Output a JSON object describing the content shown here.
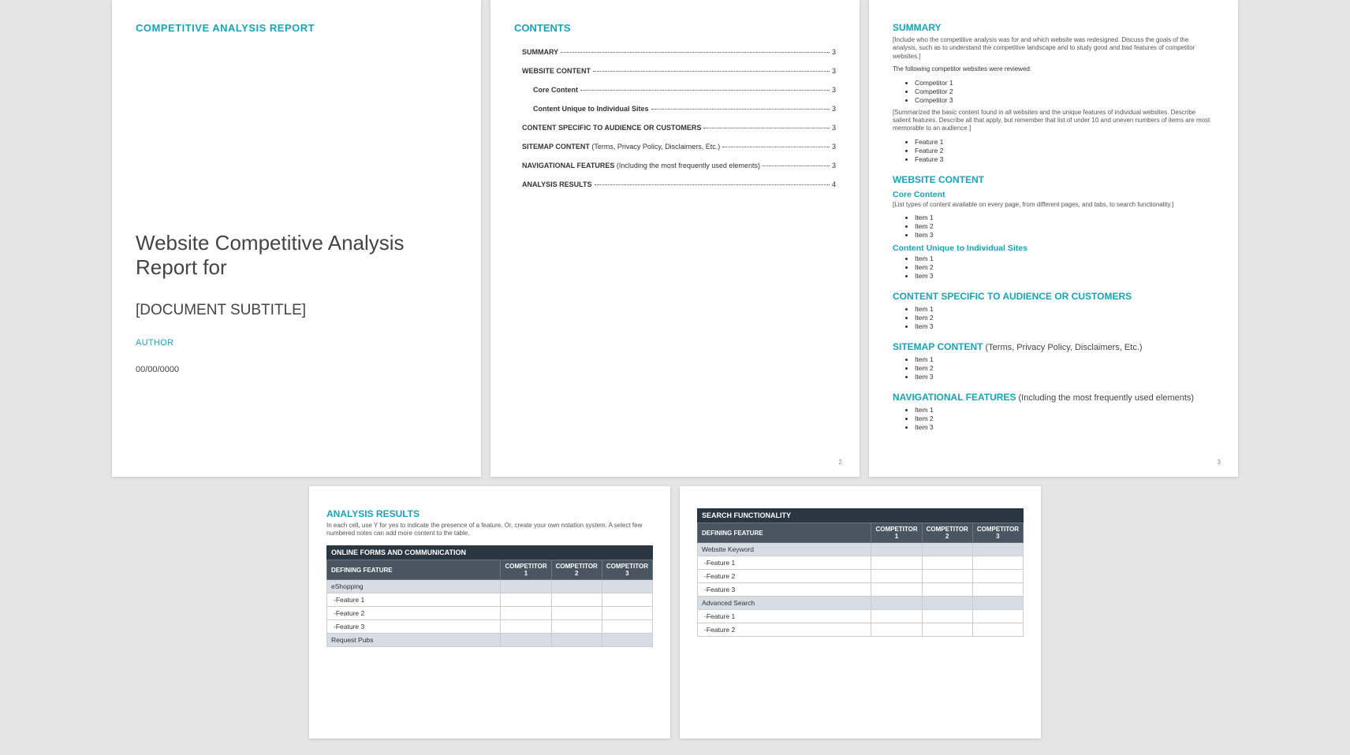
{
  "page1": {
    "header": "COMPETITIVE ANALYSIS REPORT",
    "title": "Website Competitive Analysis Report for",
    "subtitle": "[DOCUMENT SUBTITLE]",
    "author": "AUTHOR",
    "date": "00/00/0000"
  },
  "page2": {
    "heading": "CONTENTS",
    "toc": [
      {
        "label": "SUMMARY",
        "page": "3",
        "sub": false
      },
      {
        "label": "WEBSITE CONTENT",
        "page": "3",
        "sub": false
      },
      {
        "label": "Core Content",
        "page": "3",
        "sub": true
      },
      {
        "label": "Content Unique to Individual Sites",
        "page": "3",
        "sub": true
      },
      {
        "label": "CONTENT SPECIFIC TO AUDIENCE OR CUSTOMERS",
        "page": "3",
        "sub": false
      },
      {
        "label": "SITEMAP CONTENT",
        "note": " (Terms, Privacy Policy, Disclaimers, Etc.)",
        "page": "3",
        "sub": false
      },
      {
        "label": "NAVIGATIONAL FEATURES",
        "note": " (Including the most frequently used elements)",
        "page": "3",
        "sub": false
      },
      {
        "label": "ANALYSIS RESULTS",
        "page": "4",
        "sub": false
      }
    ],
    "pageNum": "2"
  },
  "page3": {
    "summary": {
      "heading": "SUMMARY",
      "intro": "[Include who the competitive analysis was for and which website was redesigned. Discuss the goals of the analysis, such as to understand the competitive landscape and to study good and bad features of competitor websites.]",
      "reviewedLine": "The following competitor websites were reviewed:",
      "competitors": [
        "Competitor 1",
        "Competitor 2",
        "Competitor 3"
      ],
      "summarized": "[Summarized the basic content found in all websites and the unique features of individual websites. Describe salient features. Describe all that apply, but remember that list of under 10 and uneven numbers of items are most memorable to an audience.]",
      "features": [
        "Feature 1",
        "Feature 2",
        "Feature 3"
      ]
    },
    "website": {
      "heading": "WEBSITE CONTENT",
      "core": {
        "heading": "Core Content",
        "desc": "[List types of content available on every page, from different pages, and tabs, to search functionality.]",
        "items": [
          "Item 1",
          "Item 2",
          "Item 3"
        ]
      },
      "unique": {
        "heading": "Content Unique to Individual Sites",
        "items": [
          "Item 1",
          "Item 2",
          "Item 3"
        ]
      }
    },
    "audience": {
      "heading": "CONTENT SPECIFIC TO AUDIENCE OR CUSTOMERS",
      "items": [
        "Item 1",
        "Item 2",
        "Item 3"
      ]
    },
    "sitemap": {
      "heading": "SITEMAP CONTENT",
      "note": " (Terms, Privacy Policy, Disclaimers, Etc.)",
      "items": [
        "Item 1",
        "Item 2",
        "Item 3"
      ]
    },
    "nav": {
      "heading": "NAVIGATIONAL FEATURES",
      "note": " (Including the most frequently used elements)",
      "items": [
        "Item 1",
        "Item 2",
        "Item 3"
      ]
    },
    "pageNum": "3"
  },
  "page4": {
    "heading": "ANALYSIS RESULTS",
    "desc": "In each cell, use Y for yes to indicate the presence of a feature. Or, create your own notation system. A select few numbered notes can add more content to the table.",
    "group": "ONLINE FORMS AND COMMUNICATION",
    "cols": [
      "DEFINING FEATURE",
      "COMPETITOR 1",
      "COMPETITOR 2",
      "COMPETITOR 3"
    ],
    "rows": [
      {
        "t": "cat",
        "label": "eShopping"
      },
      {
        "t": "feat",
        "label": "-Feature 1"
      },
      {
        "t": "feat",
        "label": "-Feature 2"
      },
      {
        "t": "feat",
        "label": "-Feature 3"
      },
      {
        "t": "cat",
        "label": "Request Pubs"
      }
    ]
  },
  "page5": {
    "group": "SEARCH FUNCTIONALITY",
    "cols": [
      "DEFINING FEATURE",
      "COMPETITOR 1",
      "COMPETITOR 2",
      "COMPETITOR 3"
    ],
    "rows": [
      {
        "t": "cat",
        "label": "Website Keyword"
      },
      {
        "t": "feat",
        "label": "-Feature 1"
      },
      {
        "t": "feat",
        "label": "-Feature 2"
      },
      {
        "t": "feat",
        "label": "-Feature 3"
      },
      {
        "t": "cat",
        "label": "Advanced Search"
      },
      {
        "t": "feat",
        "label": "-Feature 1"
      },
      {
        "t": "feat",
        "label": "-Feature 2"
      }
    ]
  }
}
